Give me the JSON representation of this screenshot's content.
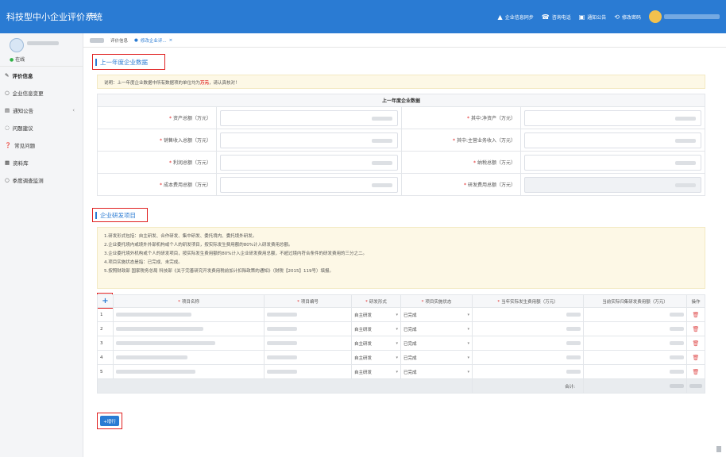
{
  "app": {
    "title": "科技型中小企业评价系统",
    "menu_icon": "≡"
  },
  "topnav": [
    {
      "icon": "▲",
      "label": "企业信息同步"
    },
    {
      "icon": "☎",
      "label": "咨询电话"
    },
    {
      "icon": "▣",
      "label": "通知公告"
    },
    {
      "icon": "⟲",
      "label": "修改密码"
    }
  ],
  "sidebar": {
    "status": "在线",
    "items": [
      {
        "icon": "✎",
        "label": "评价信息"
      },
      {
        "icon": "○",
        "label": "企业信息变更"
      },
      {
        "icon": "▤",
        "label": "通知公告"
      },
      {
        "icon": "◌",
        "label": "问题建议"
      },
      {
        "icon": "❓",
        "label": "常见问题"
      },
      {
        "icon": "▦",
        "label": "资料库"
      },
      {
        "icon": "○",
        "label": "季度调查监测"
      }
    ]
  },
  "tabs": [
    {
      "label": "评价信息"
    },
    {
      "label": "修改企业评..."
    }
  ],
  "section1": {
    "title": "上一年度企业数据",
    "notice_prefix": "说明：上一年度企业数据中所有数据项的单位均为",
    "notice_emph": "万元",
    "notice_suffix": "，请认真核对！",
    "table_header": "上一年度企业数据",
    "rows": [
      {
        "left": "资产总额（万元）",
        "right": "其中:净资产（万元）"
      },
      {
        "left": "销售收入总额（万元）",
        "right": "其中:主营业务收入（万元）"
      },
      {
        "left": "利润总额（万元）",
        "right": "纳税总额（万元）"
      },
      {
        "left": "成本费用总额（万元）",
        "right": "研发费用总额（万元）"
      }
    ]
  },
  "section2": {
    "title": "企业研发项目",
    "notes": [
      "1.研发形式包括：自主研发、合作研发、集中研发、委托境内、委托境外研发。",
      "2.企业委托境内或境外外部机构或个人的研发项目，按实际发生费用额的80%计入研发费用总额。",
      "3.企业委托境外机构或个人的研发项目，按实际发生费用额的80%计入企业研发费用总额，不超过境内符合条件的研发费用的三分之二。",
      "4.项目实施状态是指：已完成、未完成。",
      "5.按照财政部 国家税务总局 科技部《关于完善研究开发费用税前加计扣除政策的通知》（财税【2015】119号）填报。"
    ],
    "columns": [
      "+",
      "项目名称",
      "项目编号",
      "研发形式",
      "项目实施状态",
      "当年实际发生费用额（万元）",
      "当前实际归集研发费用额（万元）",
      "操作"
    ],
    "rows": [
      {
        "no": "1",
        "form": "自主研发",
        "status": "已完成"
      },
      {
        "no": "2",
        "form": "自主研发",
        "status": "已完成"
      },
      {
        "no": "3",
        "form": "自主研发",
        "status": "已完成"
      },
      {
        "no": "4",
        "form": "自主研发",
        "status": "已完成"
      },
      {
        "no": "5",
        "form": "自主研发",
        "status": "已完成"
      }
    ],
    "total_label": "合计:",
    "add_row_button": "+增行",
    "delete_icon": "trash-icon",
    "caret": "▾"
  }
}
